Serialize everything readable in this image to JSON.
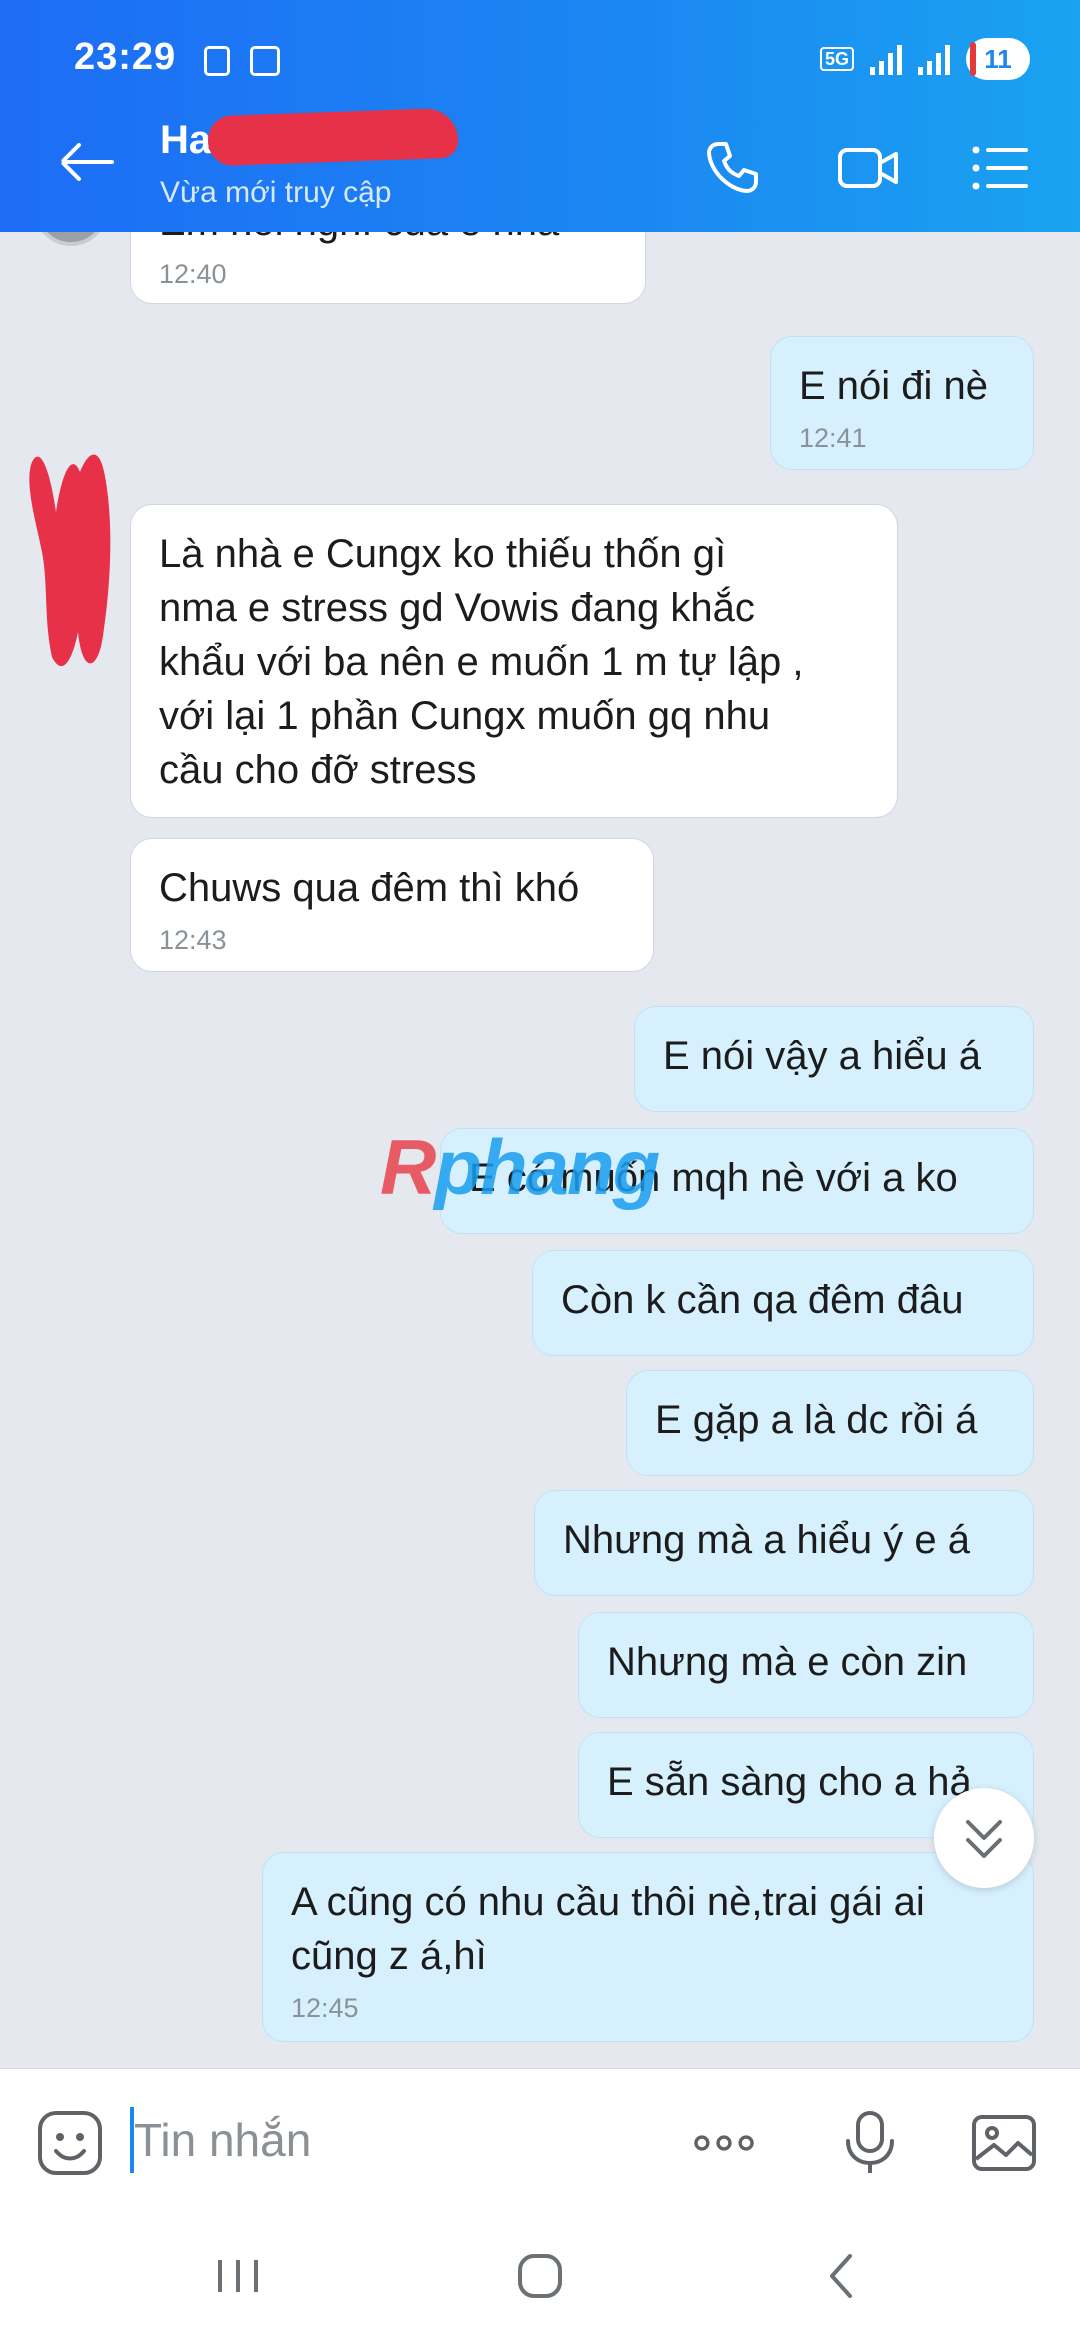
{
  "status_bar": {
    "time": "23:29",
    "network": "5G",
    "battery": "11"
  },
  "header": {
    "contact_name": "Ha",
    "contact_status": "Vừa mới truy cập"
  },
  "messages": [
    {
      "direction": "in",
      "text": "Em nói nghĩ của e nha",
      "time": "12:40"
    },
    {
      "direction": "out",
      "text": "E nói đi nè",
      "time": "12:41"
    },
    {
      "direction": "in",
      "lines": [
        "Là nhà e Cungx ko thiếu thốn gì",
        "nma e stress gd Vowis đang khắc",
        "khẩu với ba nên e muốn 1 m tự lập ,",
        "với lại 1 phần Cungx muốn gq nhu",
        "cầu cho đỡ stress"
      ]
    },
    {
      "direction": "in",
      "text": "Chuws qua đêm thì khó",
      "time": "12:43"
    },
    {
      "direction": "out",
      "text": "E nói vậy a hiểu á"
    },
    {
      "direction": "out",
      "text": "E có muốn mqh nè với a ko"
    },
    {
      "direction": "out",
      "text": "Còn k cần qa đêm đâu"
    },
    {
      "direction": "out",
      "text": "E gặp a là dc rồi á"
    },
    {
      "direction": "out",
      "text": "Nhưng mà a hiểu ý e á"
    },
    {
      "direction": "out",
      "text": "Nhưng mà e còn zin"
    },
    {
      "direction": "out",
      "text": "E sẵn sàng cho a hả"
    },
    {
      "direction": "out",
      "lines": [
        "A cũng có nhu cầu thôi nè,trai gái ai",
        "cũng z á,hì"
      ],
      "time": "12:45"
    }
  ],
  "watermark": {
    "part1": "R",
    "part2": "phang"
  },
  "composer": {
    "placeholder": "Tin nhắn"
  },
  "colors": {
    "header": "#1b88f2",
    "outgoing_bubble": "#d6f0fd",
    "incoming_bubble": "#ffffff",
    "chat_bg": "#e5e9ef"
  },
  "icons": [
    "back-arrow-icon",
    "phone-icon",
    "video-icon",
    "menu-list-icon",
    "sticker-icon",
    "more-icon",
    "mic-icon",
    "gallery-icon",
    "chevron-double-down-icon"
  ]
}
